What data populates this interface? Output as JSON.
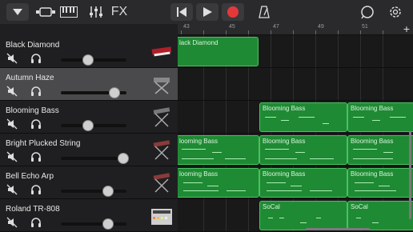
{
  "toolbar": {
    "menu_icon": "dropdown-triangle-icon",
    "fx_label": "FX",
    "record_color": "#e5383b"
  },
  "ruler": {
    "labels": [
      "43",
      "45",
      "47",
      "49",
      "51"
    ],
    "add_label": "+"
  },
  "tracks": [
    {
      "name": "Black Diamond",
      "volume": 0.42,
      "selected": false
    },
    {
      "name": "Autumn Haze",
      "volume": 0.82,
      "selected": true
    },
    {
      "name": "Blooming Bass",
      "volume": 0.42,
      "selected": false
    },
    {
      "name": "Bright Plucked String",
      "volume": 0.95,
      "selected": false
    },
    {
      "name": "Bell Echo Arp",
      "volume": 0.72,
      "selected": false
    },
    {
      "name": "Roland TR-808",
      "volume": 0.72,
      "selected": false
    }
  ],
  "regions": {
    "r0": "lack Diamond",
    "r1": "Blooming Bass",
    "r2": "Blooming Bass",
    "r3": "looming Bass",
    "r4": "Blooming Bass",
    "r5": "Blooming Bass",
    "r6": "looming Bass",
    "r7": "Blooming Bass",
    "r8": "Blooming Bass",
    "r9": "SoCal",
    "r10": "SoCal"
  },
  "colors": {
    "region_fill": "#1f8a34",
    "region_border": "#48c25f",
    "accent_record": "#e5383b"
  }
}
